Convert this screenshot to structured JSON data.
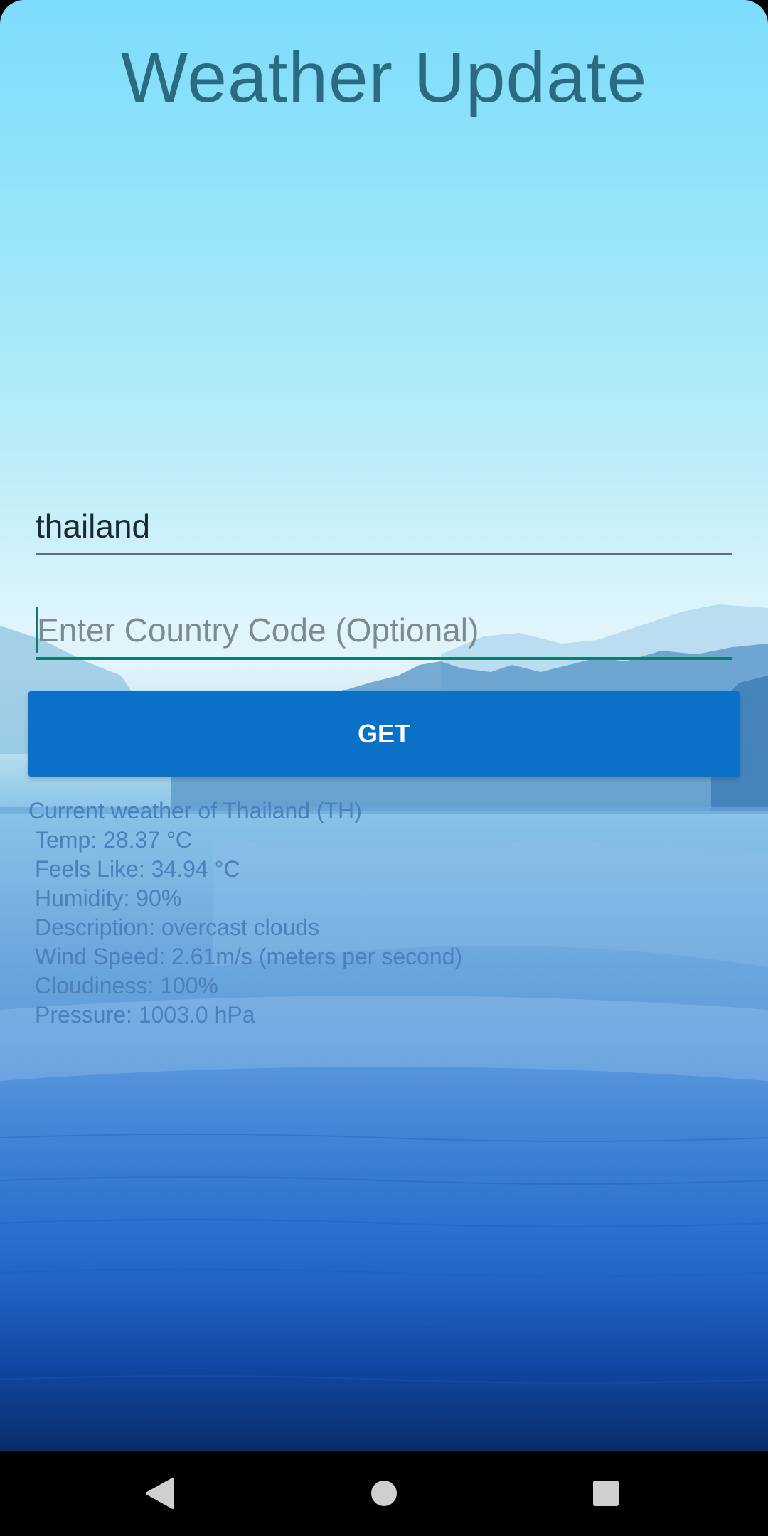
{
  "app": {
    "title": "Weather Update"
  },
  "form": {
    "city_value": "thailand",
    "country_code_placeholder": "Enter Country Code (Optional)",
    "get_label": "GET"
  },
  "result": {
    "heading": "Current weather of Thailand (TH)",
    "lines": [
      "Temp: 28.37 °C",
      "Feels Like: 34.94 °C",
      "Humidity: 90%",
      "Description: overcast clouds",
      "Wind Speed: 2.61m/s (meters per second)",
      "Cloudiness: 100%",
      "Pressure: 1003.0 hPa"
    ]
  },
  "navbar": {
    "back_icon": "back-triangle-icon",
    "home_icon": "home-circle-icon",
    "recent_icon": "recent-square-icon"
  },
  "colors": {
    "button": "#0a70c8",
    "accent_underline": "#127a6e",
    "title_text": "#2a6b82",
    "result_text": "#4d7fbd"
  }
}
